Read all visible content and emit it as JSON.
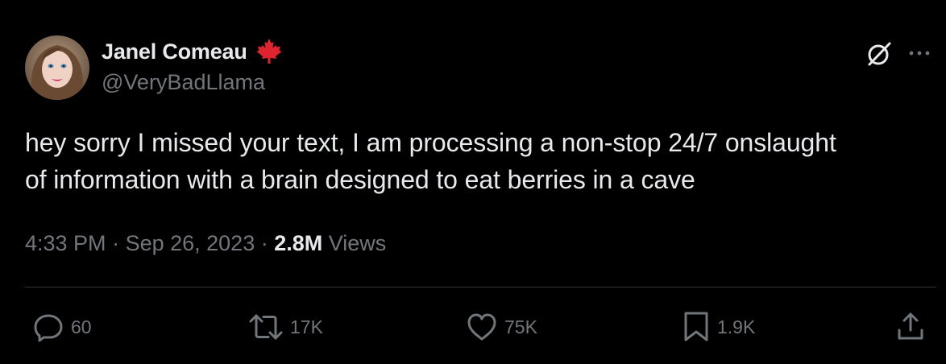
{
  "author": {
    "display_name": "Janel Comeau",
    "handle": "@VeryBadLlama",
    "avatar_icon": "profile-photo",
    "badge_icon": "maple-leaf-icon",
    "badge_color": "#e0242d"
  },
  "header_actions": {
    "grok_icon": "grok-icon",
    "more_icon": "more-options-icon"
  },
  "tweet": {
    "text": "hey sorry I missed your text, I am processing a non-stop 24/7 onslaught\nof information with a brain designed to eat berries in a cave"
  },
  "meta": {
    "time": "4:33 PM",
    "separator_1": " · ",
    "date": "Sep 26, 2023",
    "separator_2": " · ",
    "views_count": "2.8M",
    "views_label": " Views"
  },
  "actions": {
    "reply": {
      "icon": "reply-icon",
      "count": "60"
    },
    "retweet": {
      "icon": "retweet-icon",
      "count": "17K"
    },
    "like": {
      "icon": "heart-icon",
      "count": "75K"
    },
    "bookmark": {
      "icon": "bookmark-icon",
      "count": "1.9K"
    },
    "share": {
      "icon": "share-icon"
    }
  },
  "colors": {
    "background": "#000000",
    "primary_text": "#e7e9ea",
    "secondary_text": "#71767b",
    "divider": "#2f3336"
  }
}
